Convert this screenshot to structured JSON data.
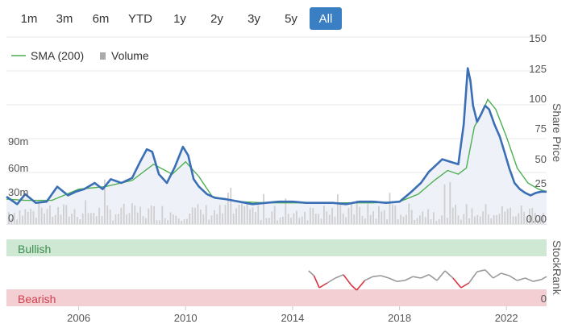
{
  "range_selector": {
    "buttons": [
      "1m",
      "3m",
      "6m",
      "YTD",
      "1y",
      "2y",
      "3y",
      "5y",
      "All"
    ],
    "active": "All",
    "active_color": "#3a7ec4"
  },
  "legend": {
    "sma_label": "SMA (200)",
    "volume_label": "Volume"
  },
  "colors": {
    "price_line": "#3a6fb5",
    "sma_line": "#4caf50",
    "volume_bars": "#cfcfcf",
    "bullish_band": "#cfe8d4",
    "bearish_band": "#f3cfd3",
    "bullish_text": "#3c8c4e",
    "bearish_text": "#d0404f",
    "stockrank_line": "#999999",
    "stockrank_bearish_line": "#d9333f"
  },
  "chart_data": [
    {
      "type": "line",
      "title": "",
      "x_axis": {
        "ticks": [
          "2006",
          "2010",
          "2014",
          "2018",
          "2022"
        ],
        "range": [
          2003.3,
          2023.5
        ]
      },
      "y_axis_right": {
        "label": "Share Price",
        "ticks": [
          "150",
          "125",
          "100",
          "75",
          "50",
          "25",
          "0.00"
        ],
        "range": [
          0,
          150
        ]
      },
      "y_axis_left": {
        "label": "",
        "ticks": [
          "90m",
          "60m",
          "30m",
          "0"
        ],
        "range": [
          0,
          180
        ]
      },
      "series": [
        {
          "name": "Share Price",
          "x": [
            2003.3,
            2003.7,
            2004.0,
            2004.4,
            2004.8,
            2005.2,
            2005.6,
            2005.9,
            2006.2,
            2006.6,
            2006.9,
            2007.2,
            2007.6,
            2008.0,
            2008.3,
            2008.55,
            2008.75,
            2009.0,
            2009.3,
            2009.6,
            2009.9,
            2010.1,
            2010.3,
            2010.5,
            2010.8,
            2011.1,
            2011.5,
            2012.0,
            2012.5,
            2013.0,
            2013.5,
            2014.0,
            2014.5,
            2015.0,
            2015.5,
            2016.0,
            2016.5,
            2017.0,
            2017.5,
            2018.0,
            2018.4,
            2018.8,
            2019.1,
            2019.3,
            2019.6,
            2019.9,
            2020.2,
            2020.4,
            2020.55,
            2020.65,
            2020.75,
            2020.9,
            2021.05,
            2021.2,
            2021.35,
            2021.55,
            2021.75,
            2021.95,
            2022.1,
            2022.3,
            2022.5,
            2022.7,
            2022.9,
            2023.1,
            2023.3,
            2023.5
          ],
          "values": [
            22,
            16,
            24,
            17,
            18,
            30,
            23,
            26,
            28,
            33,
            28,
            36,
            33,
            37,
            50,
            60,
            58,
            40,
            33,
            46,
            62,
            55,
            36,
            30,
            24,
            21,
            20,
            18,
            16,
            17,
            18,
            18,
            17,
            17,
            17,
            16,
            18,
            18,
            17,
            18,
            25,
            33,
            42,
            46,
            52,
            50,
            48,
            80,
            125,
            115,
            95,
            82,
            88,
            95,
            92,
            80,
            70,
            56,
            45,
            33,
            28,
            25,
            23,
            25,
            26,
            26
          ]
        },
        {
          "name": "SMA (200)",
          "x": [
            2003.3,
            2004.0,
            2005.0,
            2006.0,
            2007.0,
            2008.0,
            2008.8,
            2009.5,
            2010.0,
            2010.5,
            2011.0,
            2012.0,
            2013.0,
            2014.0,
            2015.0,
            2016.0,
            2017.0,
            2018.0,
            2018.7,
            2019.3,
            2019.8,
            2020.2,
            2020.5,
            2020.8,
            2021.1,
            2021.3,
            2021.6,
            2022.0,
            2022.4,
            2022.8,
            2023.2,
            2023.5
          ],
          "values": [
            20,
            19,
            19,
            28,
            30,
            35,
            48,
            40,
            50,
            38,
            22,
            18,
            17,
            17,
            17,
            17,
            17,
            18,
            24,
            35,
            43,
            40,
            45,
            78,
            90,
            100,
            92,
            70,
            45,
            33,
            28,
            26
          ]
        }
      ]
    },
    {
      "type": "line",
      "title": "",
      "y_axis_right": {
        "label": "StockRank",
        "ticks": [
          "0"
        ]
      },
      "bands": [
        "Bullish",
        "Bearish"
      ],
      "series": [
        {
          "name": "StockRank",
          "x": [
            2014.6,
            2014.8,
            2015.0,
            2015.3,
            2015.6,
            2015.9,
            2016.2,
            2016.4,
            2016.7,
            2017.0,
            2017.3,
            2017.6,
            2017.9,
            2018.2,
            2018.5,
            2018.8,
            2019.1,
            2019.4,
            2019.7,
            2020.0,
            2020.3,
            2020.6,
            2020.9,
            2021.2,
            2021.5,
            2021.8,
            2022.1,
            2022.4,
            2022.7,
            2023.0,
            2023.3,
            2023.5
          ],
          "values": [
            70,
            60,
            35,
            45,
            55,
            62,
            40,
            30,
            50,
            58,
            60,
            55,
            48,
            50,
            58,
            55,
            62,
            50,
            70,
            55,
            35,
            45,
            68,
            72,
            55,
            65,
            60,
            50,
            55,
            48,
            52,
            58
          ]
        }
      ]
    }
  ]
}
